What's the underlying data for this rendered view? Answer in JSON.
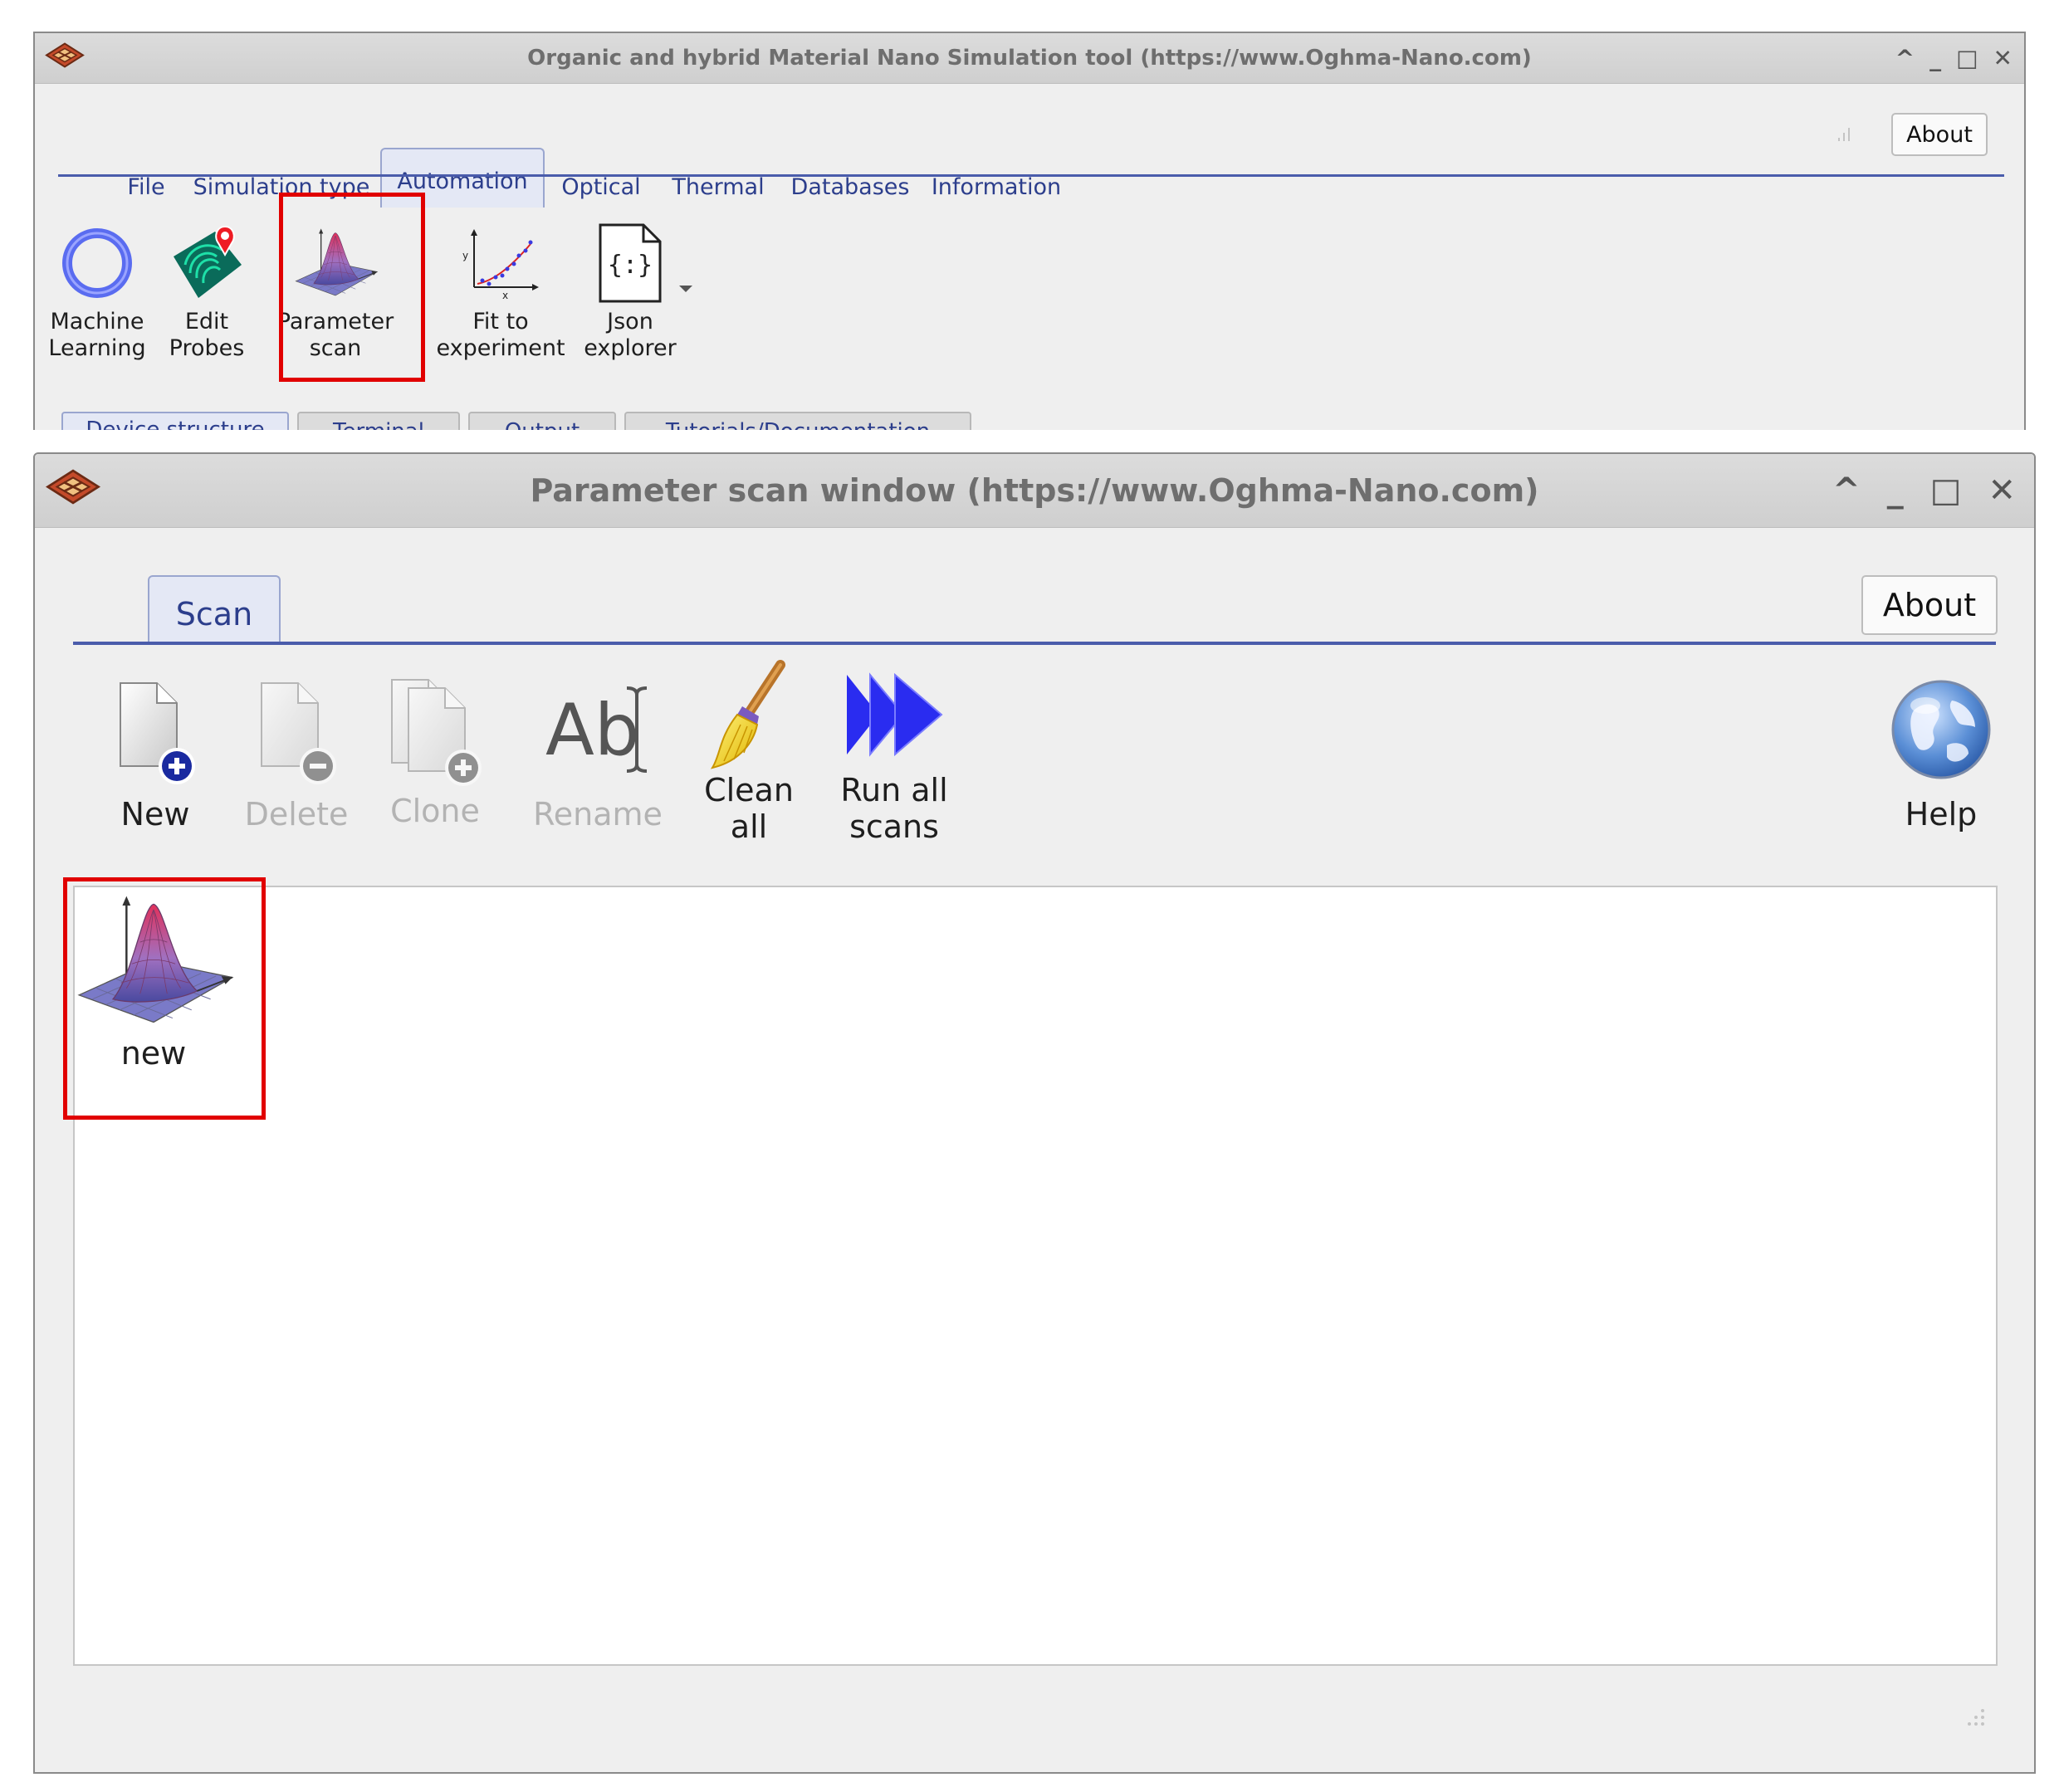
{
  "main_window": {
    "title": "Organic and hybrid Material Nano Simulation tool (https://www.Oghma-Nano.com)",
    "controls": {
      "collapse": "^",
      "minimize": "_",
      "maximize": "□",
      "close": "✕"
    },
    "tabs": [
      {
        "label": "File",
        "active": false
      },
      {
        "label": "Simulation type",
        "active": false
      },
      {
        "label": "Automation",
        "active": true
      },
      {
        "label": "Optical",
        "active": false
      },
      {
        "label": "Thermal",
        "active": false
      },
      {
        "label": "Databases",
        "active": false
      },
      {
        "label": "Information",
        "active": false
      }
    ],
    "about_label": "About",
    "toolbar": [
      {
        "label": "Machine\nLearning",
        "icon": "ring-icon"
      },
      {
        "label": "Edit\nProbes",
        "icon": "fingerprint-probe-icon"
      },
      {
        "label": "Parameter\nscan",
        "icon": "surface-plot-icon",
        "highlighted": true
      },
      {
        "label": "Fit to\nexperiment",
        "icon": "fit-plot-icon"
      },
      {
        "label": "Json\nexplorer",
        "icon": "json-file-icon"
      }
    ],
    "bottom_tabs": [
      {
        "label": "Device structure",
        "active": true
      },
      {
        "label": "Terminal",
        "active": false
      },
      {
        "label": "Output",
        "active": false
      },
      {
        "label": "Tutorials/Documentation",
        "active": false
      }
    ]
  },
  "scan_window": {
    "title": "Parameter scan window (https://www.Oghma-Nano.com)",
    "controls": {
      "collapse": "^",
      "minimize": "_",
      "maximize": "□",
      "close": "✕"
    },
    "tab_label": "Scan",
    "about_label": "About",
    "toolbar": [
      {
        "label": "New",
        "icon": "new-file-icon",
        "enabled": true
      },
      {
        "label": "Delete",
        "icon": "delete-file-icon",
        "enabled": false
      },
      {
        "label": "Clone",
        "icon": "clone-file-icon",
        "enabled": false
      },
      {
        "label": "Rename",
        "icon": "rename-icon",
        "enabled": false
      },
      {
        "label": "Clean\nall",
        "icon": "broom-icon",
        "enabled": true
      },
      {
        "label": "Run all\nscans",
        "icon": "fast-forward-icon",
        "enabled": true
      }
    ],
    "help_label": "Help",
    "items": [
      {
        "label": "new",
        "icon": "surface-plot-icon",
        "highlighted": true
      }
    ]
  },
  "colors": {
    "highlight": "#e10000",
    "tab_text": "#2c3e8c",
    "tab_line": "#4a5cab",
    "run_arrow": "#2a2cf0"
  }
}
